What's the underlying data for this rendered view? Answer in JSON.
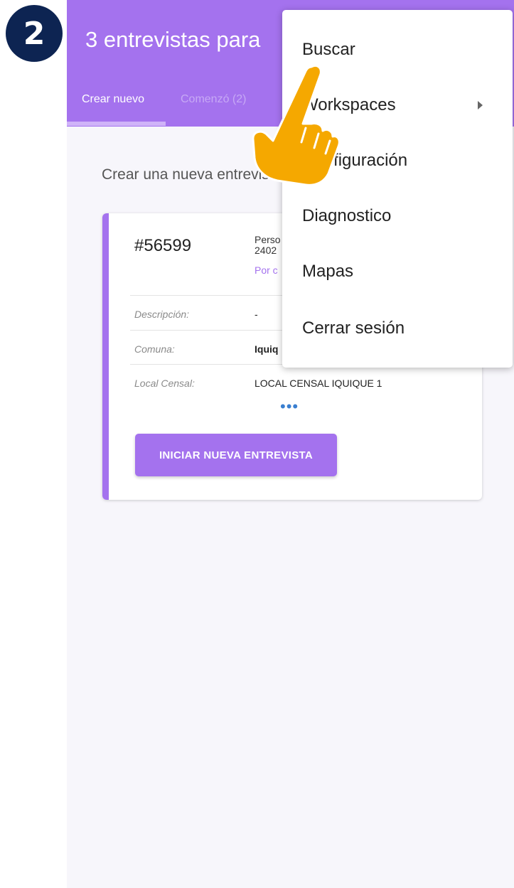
{
  "step": {
    "number": "2"
  },
  "appbar": {
    "title": "3 entrevistas para"
  },
  "tabs": [
    {
      "label": "Crear nuevo",
      "active": true
    },
    {
      "label": "Comenzó (2)",
      "active": false
    }
  ],
  "main": {
    "section_title": "Crear una nueva entrevista"
  },
  "card": {
    "id": "#56599",
    "subject_line1": "Perso",
    "subject_line2": "2402",
    "status": "Por c",
    "fields": [
      {
        "label": "Descripción:",
        "value": "-"
      },
      {
        "label": "Comuna:",
        "value": "Iquiq"
      },
      {
        "label": "Local Censal:",
        "value": "LOCAL CENSAL IQUIQUE 1"
      }
    ],
    "more": "•••",
    "start_button": "INICIAR NUEVA ENTREVISTA"
  },
  "menu": {
    "items": [
      {
        "label": "Buscar"
      },
      {
        "label": "Workspaces",
        "has_submenu": true
      },
      {
        "label": "Configuración"
      },
      {
        "label": "Diagnostico"
      },
      {
        "label": "Mapas"
      },
      {
        "label": "Cerrar sesión"
      }
    ]
  },
  "colors": {
    "accent": "#a472ee",
    "badge": "#0d2452",
    "hand": "#f5a800",
    "link_dots": "#3a7fd0"
  },
  "icons": {
    "pointer": "pointing-hand-icon",
    "submenu": "triangle-right-icon"
  }
}
